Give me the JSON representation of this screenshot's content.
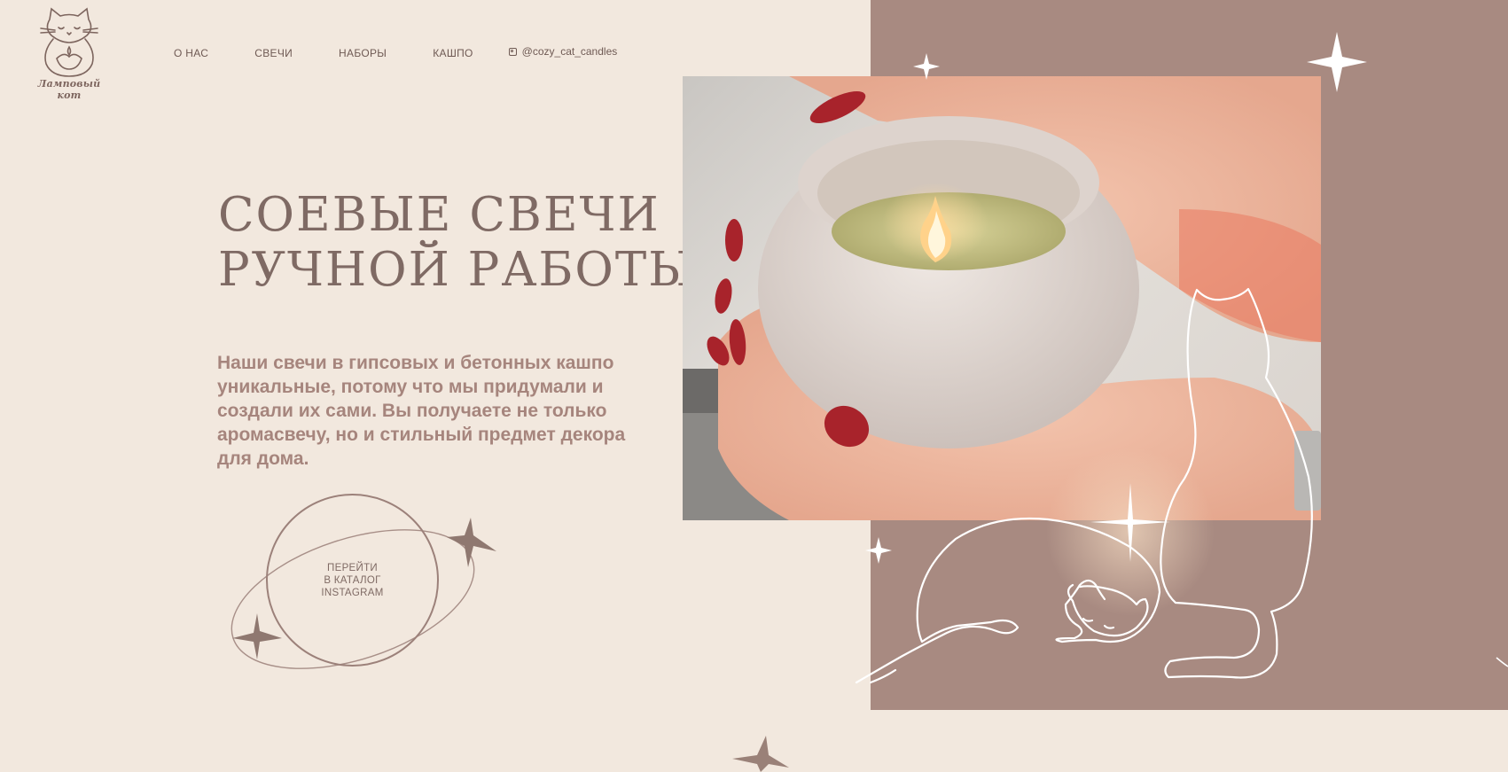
{
  "brand": {
    "logo_caption": "Ламповый кот"
  },
  "nav": {
    "items": [
      {
        "label": "О НАС"
      },
      {
        "label": "СВЕЧИ"
      },
      {
        "label": "НАБОРЫ"
      },
      {
        "label": "КАШПО"
      }
    ],
    "instagram_handle": "@cozy_cat_candles"
  },
  "hero": {
    "title_line1": "СОЕВЫЕ СВЕЧИ",
    "title_line2": "РУЧНОЙ РАБОТЫ",
    "description": "Наши свечи в гипсовых и бетонных кашпо уникальные, потому что мы придумали и создали их сами. Вы получаете не только аромасвечу, но и стильный предмет декора для дома.",
    "cta_label": "ПЕРЕЙТИ\nВ КАТАЛОГ\nINSTAGRAM"
  },
  "colors": {
    "background": "#f2e8de",
    "panel": "#a88a81",
    "text_dark": "#7f6a64",
    "text_accent": "#a6857d",
    "line_art": "#ffffff"
  },
  "icons": [
    "cat-logo-icon",
    "instagram-icon",
    "sparkle-icon",
    "cat-line-art"
  ]
}
